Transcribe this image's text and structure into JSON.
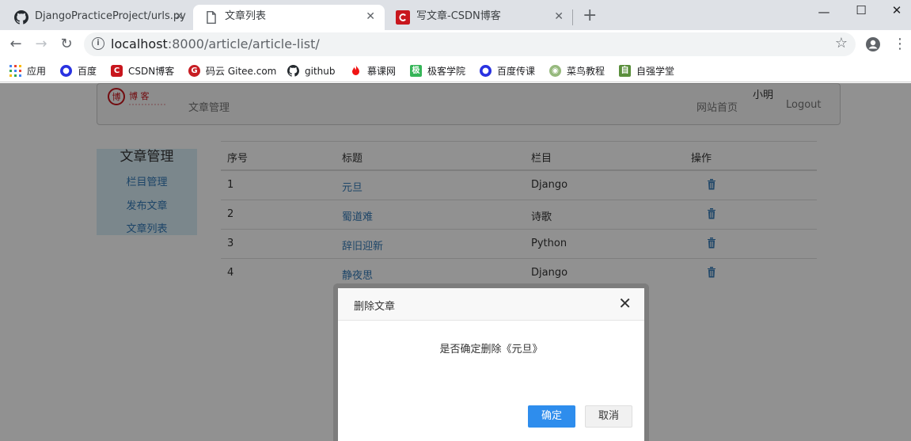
{
  "browser": {
    "tabs": [
      {
        "title": "DjangoPracticeProject/urls.py",
        "icon": "github-icon"
      },
      {
        "title": "文章列表",
        "icon": "page-icon"
      },
      {
        "title": "写文章-CSDN博客",
        "icon": "csdn-icon"
      }
    ],
    "new_tab": "+",
    "url_host": "localhost",
    "url_path": ":8000/article/article-list/",
    "bookmarks": [
      {
        "label": "应用",
        "icon": "apps-grid-icon",
        "color": "#4285f4"
      },
      {
        "label": "百度",
        "icon": "baidu-paw-icon",
        "color": "#2932e1"
      },
      {
        "label": "CSDN博客",
        "icon": "csdn-icon",
        "color": "#c8161d"
      },
      {
        "label": "码云 Gitee.com",
        "icon": "gitee-icon",
        "color": "#c71d23"
      },
      {
        "label": "github",
        "icon": "github-icon",
        "color": "#24292e"
      },
      {
        "label": "慕课网",
        "icon": "imooc-flame-icon",
        "color": "#f01414"
      },
      {
        "label": "极客学院",
        "icon": "jikexueyuan-icon",
        "color": "#35b558"
      },
      {
        "label": "百度传课",
        "icon": "baidu-paw-icon",
        "color": "#2932e1"
      },
      {
        "label": "菜鸟教程",
        "icon": "runoob-icon",
        "color": "#96b97d"
      },
      {
        "label": "自强学堂",
        "icon": "ziqiang-icon",
        "color": "#5a8f3c"
      }
    ]
  },
  "navbar": {
    "brand": "文章管理",
    "home": "网站首页",
    "user": "小明",
    "logout": "Logout",
    "logo_text": "博 客"
  },
  "sidebar": {
    "title": "文章管理",
    "items": [
      "栏目管理",
      "发布文章",
      "文章列表"
    ]
  },
  "table": {
    "headers": [
      "序号",
      "标题",
      "栏目",
      "操作"
    ],
    "rows": [
      {
        "no": "1",
        "title": "元旦",
        "column": "Django"
      },
      {
        "no": "2",
        "title": "蜀道难",
        "column": "诗歌"
      },
      {
        "no": "3",
        "title": "辞旧迎新",
        "column": "Python"
      },
      {
        "no": "4",
        "title": "静夜思",
        "column": "Django"
      }
    ]
  },
  "dialog": {
    "title": "删除文章",
    "message": "是否确定删除《元旦》",
    "ok": "确定",
    "cancel": "取消"
  },
  "colors": {
    "link": "#337ab7",
    "primary_button": "#2e8ded",
    "sidebar_bg": "#d9edf7"
  }
}
